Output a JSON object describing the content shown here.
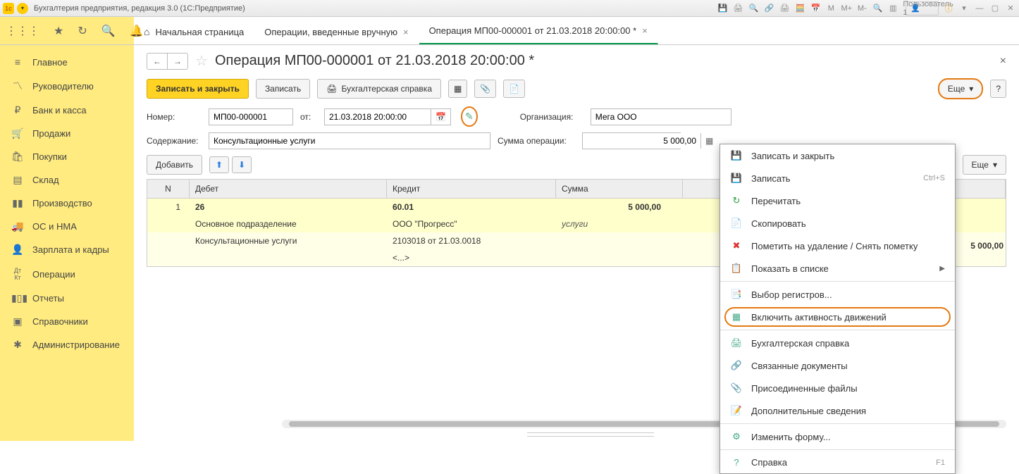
{
  "title_bar": {
    "app_title": "Бухгалтерия предприятия, редакция 3.0  (1С:Предприятие)",
    "user": "Пользователь 1",
    "m": "М",
    "mplus": "М+",
    "mminus": "М-"
  },
  "tabs": {
    "home": "Начальная страница",
    "t1": "Операции, введенные вручную",
    "t2": "Операция МП00-000001 от 21.03.2018 20:00:00 *"
  },
  "sidebar": [
    {
      "icon": "★",
      "label": "Главное"
    },
    {
      "icon": "📈",
      "label": "Руководителю"
    },
    {
      "icon": "₽",
      "label": "Банк и касса"
    },
    {
      "icon": "🛒",
      "label": "Продажи"
    },
    {
      "icon": "🛍",
      "label": "Покупки"
    },
    {
      "icon": "📦",
      "label": "Склад"
    },
    {
      "icon": "🏭",
      "label": "Производство"
    },
    {
      "icon": "🚚",
      "label": "ОС и НМА"
    },
    {
      "icon": "👤",
      "label": "Зарплата и кадры"
    },
    {
      "icon": "Дт",
      "label": "Операции"
    },
    {
      "icon": "📊",
      "label": "Отчеты"
    },
    {
      "icon": "📚",
      "label": "Справочники"
    },
    {
      "icon": "⚙",
      "label": "Администрирование"
    }
  ],
  "page": {
    "title": "Операция МП00-000001 от 21.03.2018 20:00:00 *"
  },
  "buttons": {
    "save_close": "Записать и закрыть",
    "save": "Записать",
    "accounting_ref": "Бухгалтерская справка",
    "more": "Еще",
    "help": "?",
    "add": "Добавить"
  },
  "form": {
    "number_label": "Номер:",
    "number_value": "МП00-000001",
    "from_label": "от:",
    "date_value": "21.03.2018 20:00:00",
    "org_label": "Организация:",
    "org_value": "Мега ООО",
    "content_label": "Содержание:",
    "content_value": "Консультационные услуги",
    "sum_label": "Сумма операции:",
    "sum_value": "5 000,00"
  },
  "grid": {
    "headers": {
      "n": "N",
      "debit": "Дебет",
      "credit": "Кредит",
      "sum": "Сумма"
    },
    "rows": {
      "n": "1",
      "debit1": "26",
      "credit1": "60.01",
      "sum1": "5 000,00",
      "debit2": "Основное подразделение",
      "credit2": "ООО \"Прогресс\"",
      "sum_note": "услуги",
      "debit3": "Консультационные услуги",
      "credit3": "2103018 от 21.03.0018",
      "credit4": "<...>"
    },
    "right_sum": "5 000,00"
  },
  "menu": [
    {
      "icon": "💾",
      "text": "Записать и закрыть"
    },
    {
      "icon": "💾",
      "text": "Записать",
      "key": "Ctrl+S"
    },
    {
      "icon": "↻",
      "text": "Перечитать"
    },
    {
      "icon": "📄",
      "text": "Скопировать"
    },
    {
      "icon": "✖",
      "text": "Пометить на удаление / Снять пометку"
    },
    {
      "icon": "📋",
      "text": "Показать в списке",
      "arrow": true,
      "sep_after": true
    },
    {
      "icon": "📑",
      "text": "Выбор регистров..."
    },
    {
      "icon": "▦",
      "text": "Включить активность движений",
      "highlight": true,
      "sep_after": true
    },
    {
      "icon": "🖨",
      "text": "Бухгалтерская справка"
    },
    {
      "icon": "🔗",
      "text": "Связанные документы"
    },
    {
      "icon": "📎",
      "text": "Присоединенные файлы"
    },
    {
      "icon": "📝",
      "text": "Дополнительные сведения",
      "sep_after": true
    },
    {
      "icon": "⚙",
      "text": "Изменить форму...",
      "sep_after": true
    },
    {
      "icon": "?",
      "text": "Справка",
      "key": "F1"
    }
  ]
}
